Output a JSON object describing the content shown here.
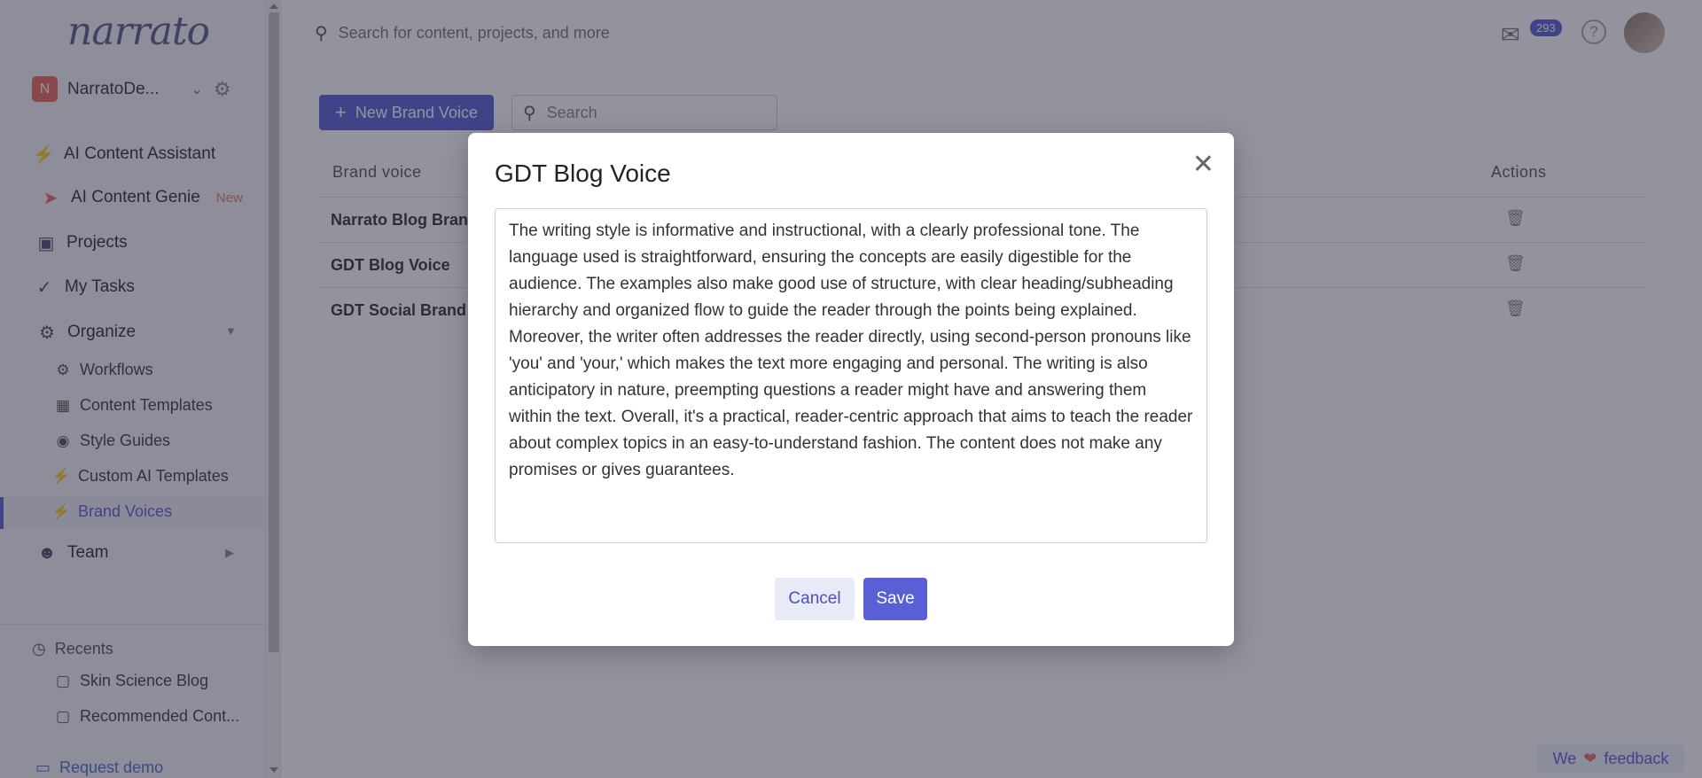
{
  "sidebar": {
    "logo": "narrato",
    "workspace": {
      "initial": "N",
      "name": "NarratoDe..."
    },
    "items": [
      {
        "label": "AI Content Assistant",
        "icon": "lightning-icon"
      },
      {
        "label": "AI Content Genie",
        "icon": "rocket-icon",
        "badge": "New"
      },
      {
        "label": "Projects",
        "icon": "briefcase-icon"
      },
      {
        "label": "My Tasks",
        "icon": "check-icon"
      },
      {
        "label": "Organize",
        "icon": "cogs-icon"
      },
      {
        "label": "Team",
        "icon": "team-icon"
      }
    ],
    "organize_items": [
      {
        "label": "Workflows",
        "icon": "robot-icon"
      },
      {
        "label": "Content Templates",
        "icon": "book-icon"
      },
      {
        "label": "Style Guides",
        "icon": "palette-icon"
      },
      {
        "label": "Custom AI Templates",
        "icon": "lightning-icon"
      },
      {
        "label": "Brand Voices",
        "icon": "lightning-icon",
        "active": true
      }
    ],
    "recents_label": "Recents",
    "recents": [
      {
        "label": "Skin Science Blog",
        "icon": "cube-icon"
      },
      {
        "label": "Recommended Cont...",
        "icon": "cube-icon"
      }
    ],
    "request_demo": "Request demo"
  },
  "topbar": {
    "search_placeholder": "Search for content, projects, and more",
    "mail_count": "293"
  },
  "toolbar": {
    "new_button": "New Brand Voice",
    "search_placeholder": "Search"
  },
  "table": {
    "headers": {
      "name": "Brand voice",
      "actions": "Actions"
    },
    "rows": [
      {
        "name": "Narrato Blog Brand"
      },
      {
        "name": "GDT Blog Voice"
      },
      {
        "name": "GDT Social Brand V"
      }
    ]
  },
  "modal": {
    "title": "GDT Blog Voice",
    "text": "The writing style is informative and instructional, with a clearly professional tone. The language used is straightforward, ensuring the concepts are easily digestible for the audience. The examples also make good use of structure, with clear heading/subheading hierarchy and organized flow to guide the reader through the points being explained. Moreover, the writer often addresses the reader directly, using second-person pronouns like 'you' and 'your,' which makes the text more engaging and personal. The writing is also anticipatory in nature, preempting questions a reader might have and answering them within the text. Overall, it's a practical, reader-centric approach that aims to teach the reader about complex topics in an easy-to-understand fashion. The content does not make any promises or gives guarantees.",
    "cancel": "Cancel",
    "save": "Save"
  },
  "feedback": {
    "pre": "We",
    "post": "feedback"
  },
  "colors": {
    "accent": "#5a5fd6",
    "brand_orange": "#e8675a"
  }
}
